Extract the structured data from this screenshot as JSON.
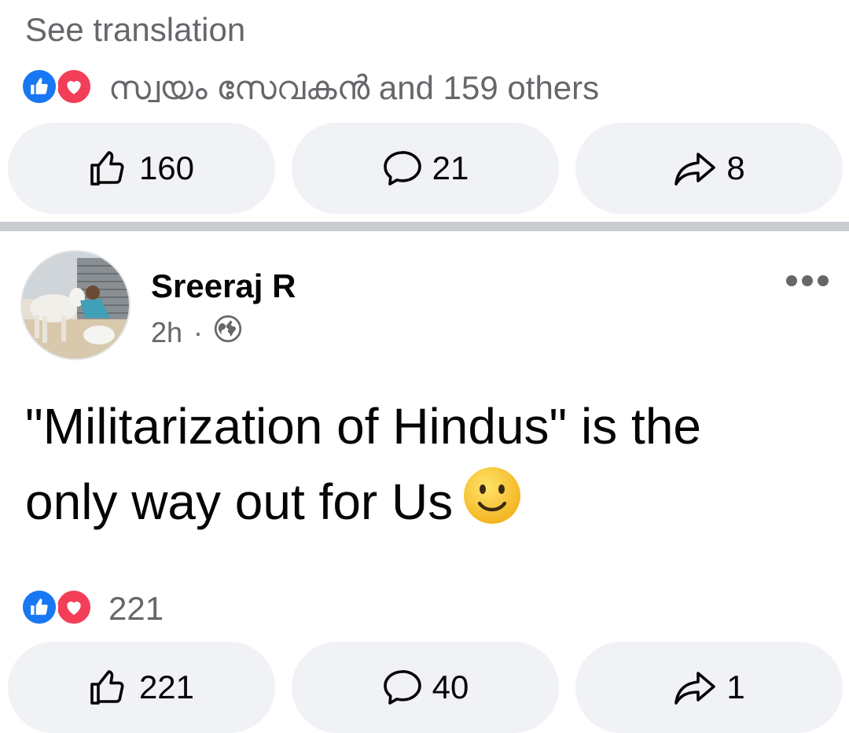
{
  "previous_post": {
    "see_translation": "See translation",
    "reaction_summary": "സ്വയം സേവകൻ and 159 others",
    "actions": {
      "like_count": "160",
      "comment_count": "21",
      "share_count": "8"
    }
  },
  "post": {
    "author": "Sreeraj R",
    "time": "2h",
    "separator": "·",
    "privacy_icon": "globe-icon",
    "text_line1": "\"Militarization of Hindus\" is the",
    "text_line2": "only way out for Us",
    "emoji": "slightly-smiling-face",
    "reaction_count": "221",
    "actions": {
      "like_count": "221",
      "comment_count": "40",
      "share_count": "1"
    }
  },
  "colors": {
    "like_blue": "#1877f2",
    "love_red": "#f33e58",
    "secondary_text": "#65676b",
    "pill_bg": "#f0f2f5"
  }
}
